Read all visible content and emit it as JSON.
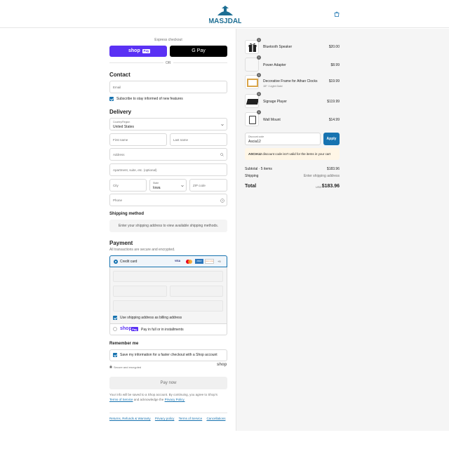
{
  "brand": {
    "logo_text": "MASJDAL"
  },
  "express": {
    "title": "Express checkout",
    "shop_pay_label": "shop",
    "shop_pay_badge": "Pay",
    "gpay_label": "G Pay",
    "or": "OR"
  },
  "contact": {
    "heading": "Contact",
    "email_placeholder": "Email",
    "subscribe_label": "Subscribe to stay informed of new features"
  },
  "delivery": {
    "heading": "Delivery",
    "country_label": "Country/Region",
    "country_value": "United States",
    "first_name": "First name",
    "last_name": "Last name",
    "address": "Address",
    "apartment": "Apartment, suite, etc. (optional)",
    "city": "City",
    "state_label": "State",
    "state_value": "Iowa",
    "zip": "ZIP code",
    "phone": "Phone"
  },
  "shipping_method": {
    "heading": "Shipping method",
    "message": "Enter your shipping address to view available shipping methods."
  },
  "payment": {
    "heading": "Payment",
    "subtitle": "All transactions are secure and encrypted.",
    "credit_card_label": "Credit card",
    "card_brands": [
      "VISA",
      "MC",
      "AMEX",
      "DISCOVER",
      "+5"
    ],
    "billing_label": "Use shipping address as billing address",
    "shoppay_option": "Pay in full or in installments"
  },
  "remember": {
    "heading": "Remember me",
    "save_label": "Save my information for a faster checkout with a Shop account",
    "secure_label": "Secure and encrypted",
    "shop_brand": "shop"
  },
  "pay_now": "Pay now",
  "legal": {
    "line1": "Your info will be saved to a Shop account. By continuing, you agree to Shop's",
    "tos": "Terms of Service",
    "and": "and acknowledge the",
    "privacy": "Privacy Policy."
  },
  "footer_links": [
    "Returns, Refunds & Warranty",
    "Privacy policy",
    "Terms of Service",
    "Cancellations"
  ],
  "cart": {
    "items": [
      {
        "name": "Bluetooth Speaker",
        "variant": "",
        "price": "$20.00",
        "qty": "1"
      },
      {
        "name": "Power Adapter",
        "variant": "",
        "price": "$8.99",
        "qty": "1"
      },
      {
        "name": "Decorative Frame for Athan Clocks",
        "variant": "15\" / Light Gold",
        "price": "$19.99",
        "qty": "1"
      },
      {
        "name": "Signage Player",
        "variant": "",
        "price": "$119.99",
        "qty": "1"
      },
      {
        "name": "Wall Mount",
        "variant": "",
        "price": "$14.99",
        "qty": "1"
      }
    ],
    "discount_label": "Discount code",
    "discount_value": "Ascia12",
    "apply": "Apply",
    "discount_warning_code": "ASCIA12",
    "discount_warning_text": "discount code isn't valid for the items in your cart",
    "subtotal_label": "Subtotal · 5 items",
    "subtotal_value": "$183.96",
    "shipping_label": "Shipping",
    "shipping_value": "Enter shipping address",
    "total_label": "Total",
    "currency": "USD",
    "total_value": "$183.96"
  },
  "colors": {
    "accent": "#1773b0",
    "shoppay": "#5a31f4",
    "warning_bg": "#fff6e6"
  }
}
